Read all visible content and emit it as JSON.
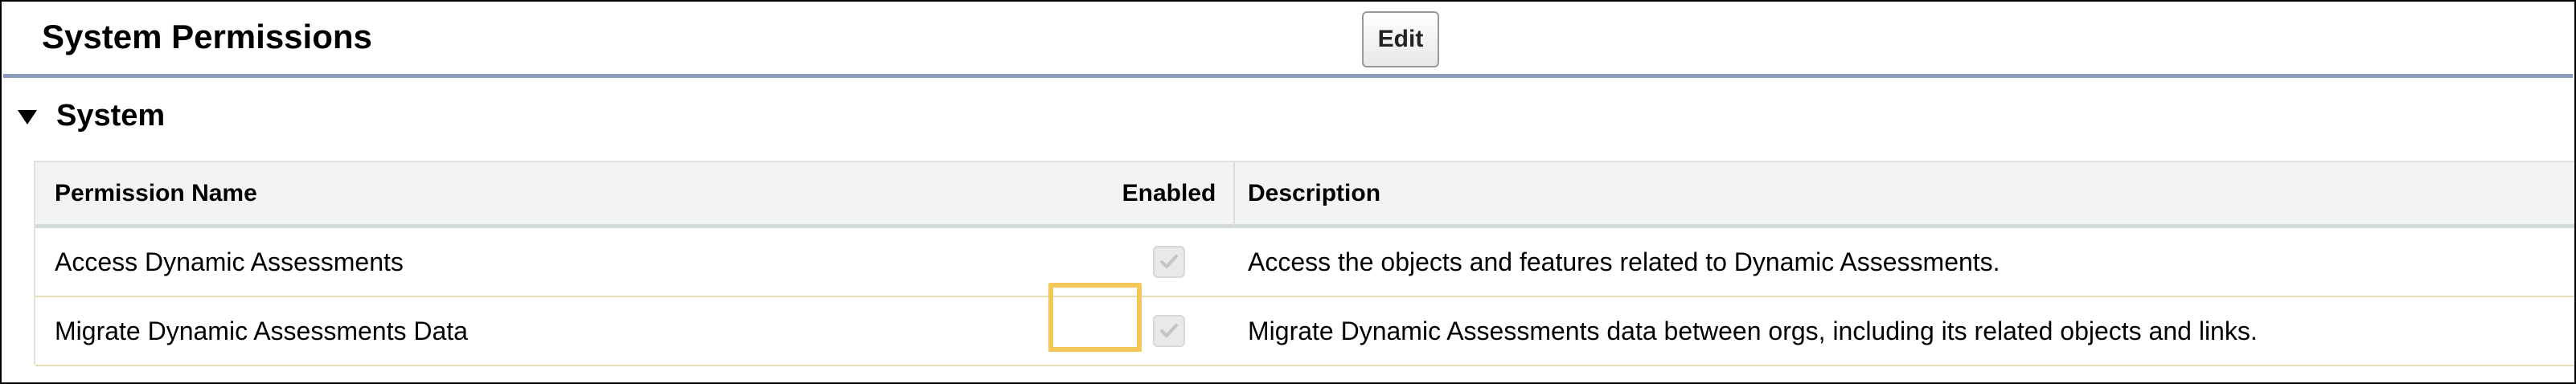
{
  "header": {
    "title": "System Permissions",
    "edit_label": "Edit"
  },
  "section": {
    "title": "System",
    "toggle_icon": "triangle-down-icon"
  },
  "table": {
    "columns": [
      "Permission Name",
      "Enabled",
      "Description"
    ],
    "rows": [
      {
        "name": "Access Dynamic Assessments",
        "enabled": true,
        "description": "Access the objects and features related to Dynamic Assessments."
      },
      {
        "name": "Migrate Dynamic Assessments Data",
        "enabled": true,
        "description": "Migrate Dynamic Assessments data between orgs, including its related objects and links."
      }
    ]
  },
  "colors": {
    "header_rule": "#8a9bbd",
    "highlight": "#f3c75a",
    "table_header_bg": "#f2f3f3"
  }
}
